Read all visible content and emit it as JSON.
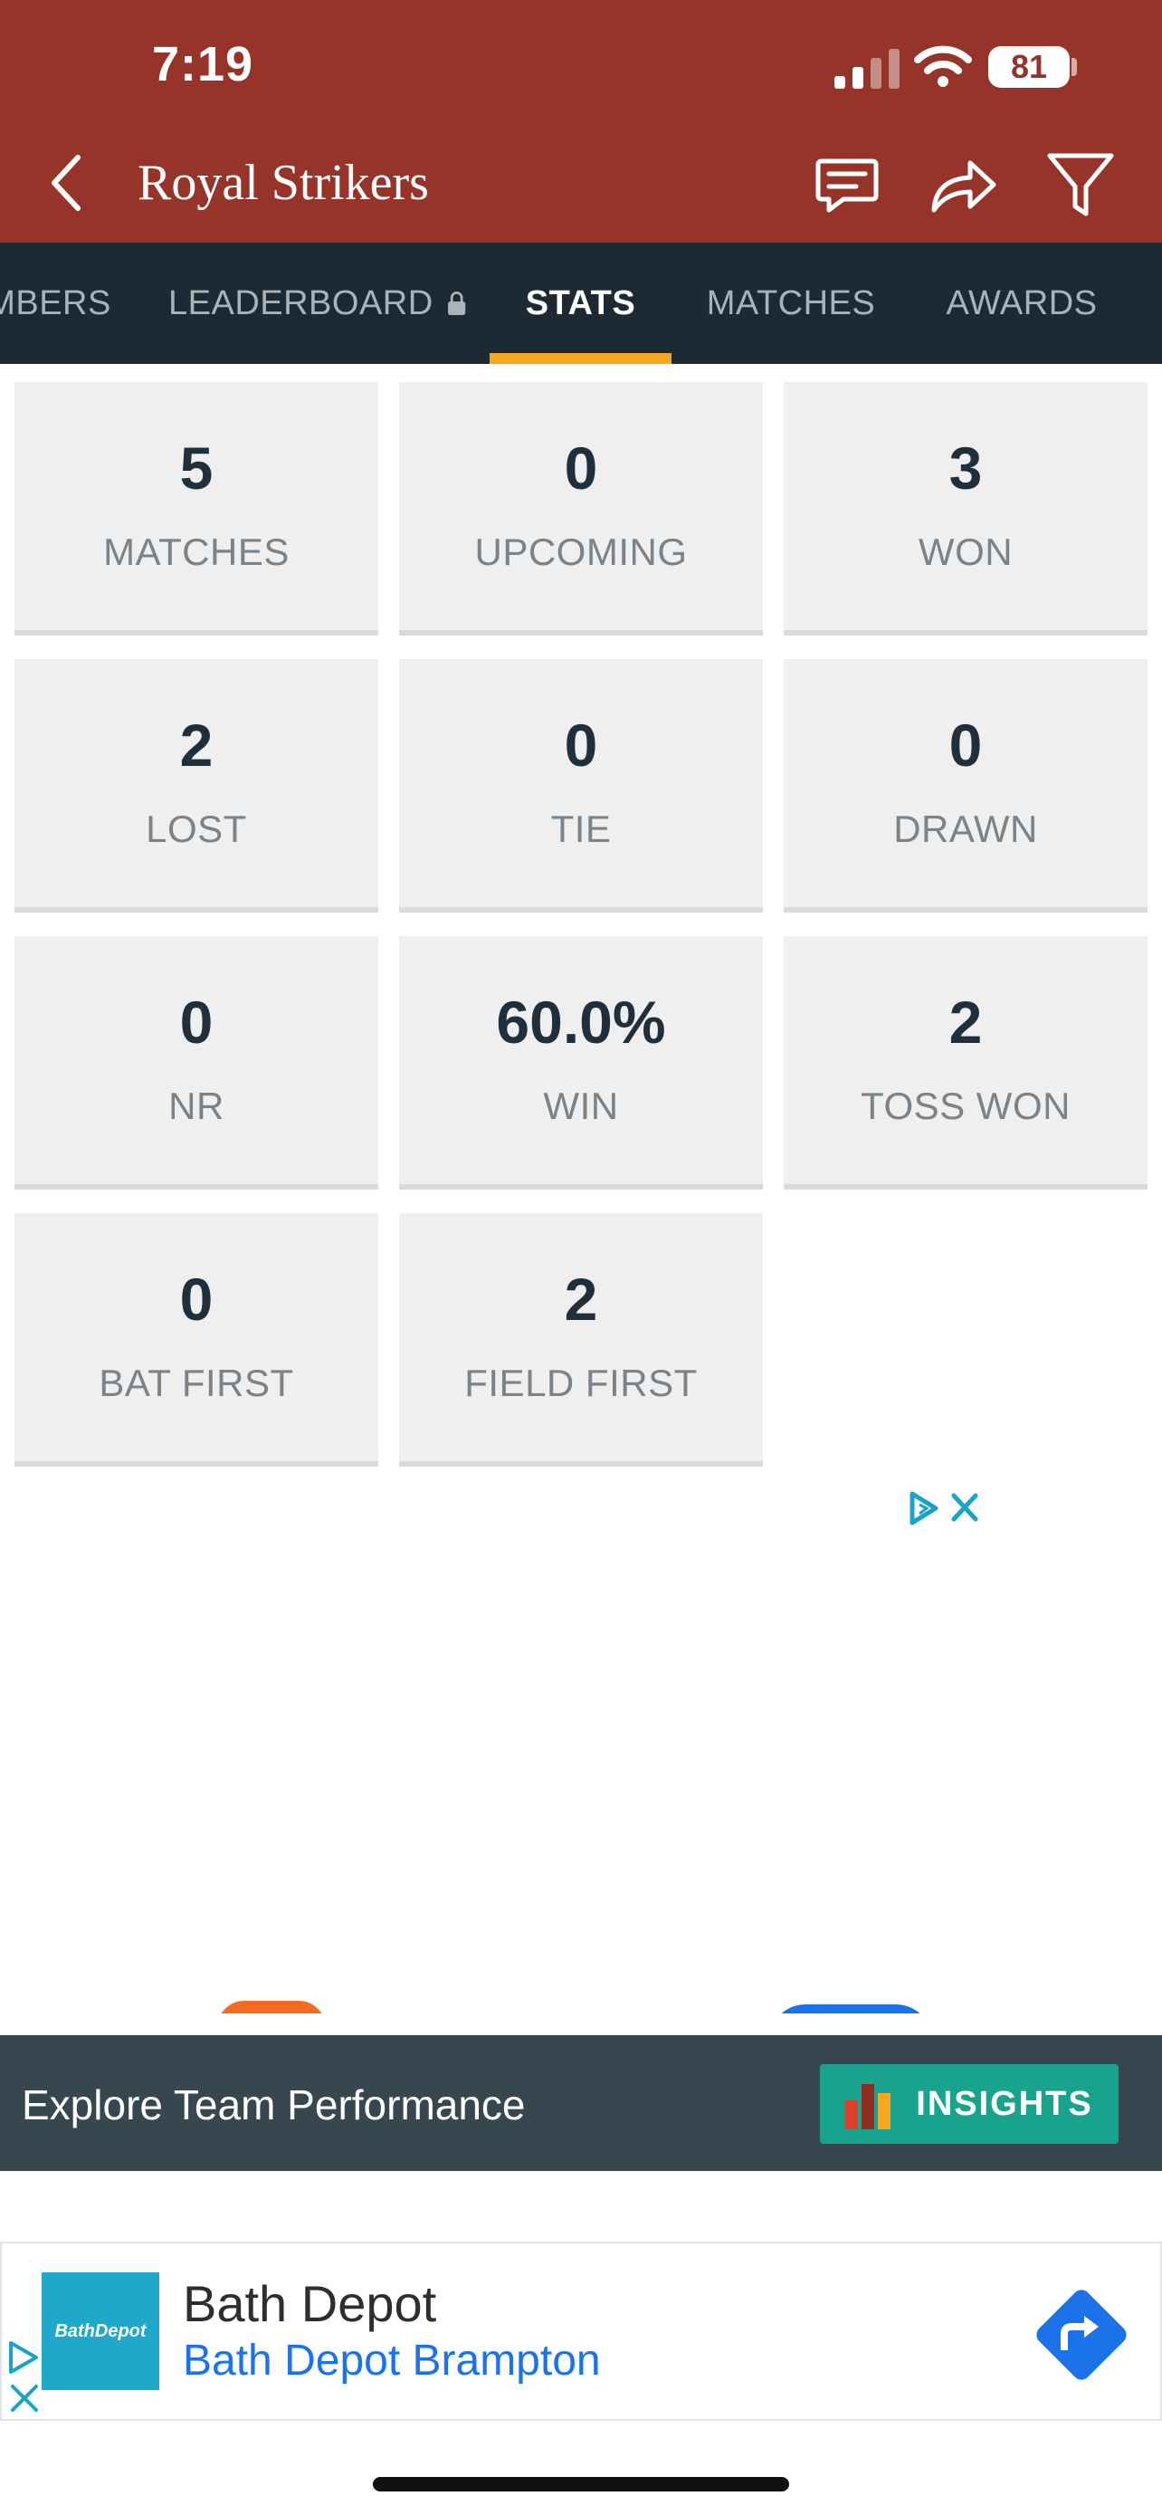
{
  "status_bar": {
    "time": "7:19",
    "battery": "81"
  },
  "header": {
    "title": "Royal Strikers",
    "icons": [
      "back-arrow-icon",
      "chat-icon",
      "share-icon",
      "filter-icon"
    ],
    "background_color": "#963429"
  },
  "tabs": [
    {
      "label": "MBERS",
      "active": false
    },
    {
      "label": "LEADERBOARD",
      "active": false,
      "locked": true
    },
    {
      "label": "STATS",
      "active": true
    },
    {
      "label": "MATCHES",
      "active": false
    },
    {
      "label": "AWARDS",
      "active": false
    }
  ],
  "tab_accent_color": "#f5a623",
  "stats": [
    {
      "value": "5",
      "label": "MATCHES"
    },
    {
      "value": "0",
      "label": "UPCOMING"
    },
    {
      "value": "3",
      "label": "WON"
    },
    {
      "value": "2",
      "label": "LOST"
    },
    {
      "value": "0",
      "label": "TIE"
    },
    {
      "value": "0",
      "label": "DRAWN"
    },
    {
      "value": "0",
      "label": "NR"
    },
    {
      "value": "60.0%",
      "label": "WIN"
    },
    {
      "value": "2",
      "label": "TOSS WON"
    },
    {
      "value": "0",
      "label": "BAT FIRST"
    },
    {
      "value": "2",
      "label": "FIELD FIRST"
    }
  ],
  "insights": {
    "text": "Explore Team Performance",
    "button_label": "INSIGHTS",
    "button_color": "#1aa38c"
  },
  "banner_ad": {
    "logo_text": "BathDepot",
    "title": "Bath Depot",
    "subtitle": "Bath Depot Brampton",
    "link_color": "#1a73e8"
  }
}
